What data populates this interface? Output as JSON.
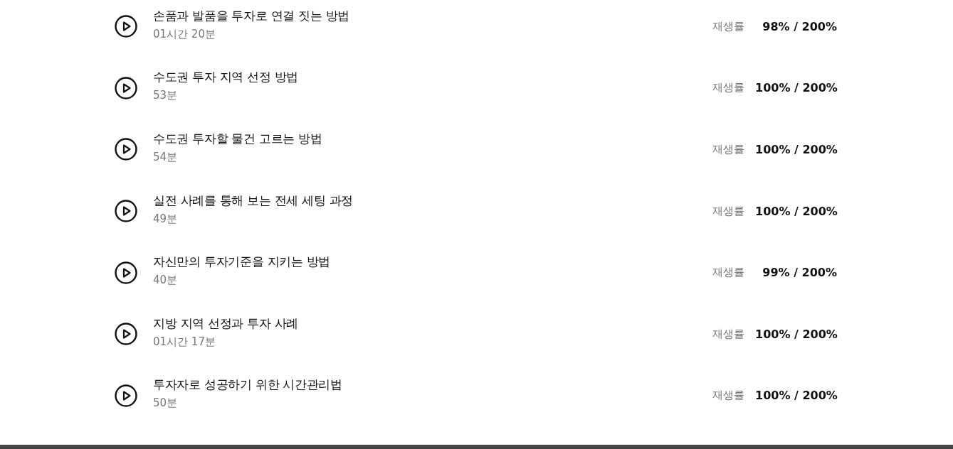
{
  "lessons": [
    {
      "title": "손품과 발품을 투자로 연결 짓는 방법",
      "duration": "01시간 20분",
      "rate_label": "재생률",
      "rate": "98% / 200%"
    },
    {
      "title": "수도권 투자 지역 선정 방법",
      "duration": "53분",
      "rate_label": "재생률",
      "rate": "100% / 200%"
    },
    {
      "title": "수도권 투자할 물건 고르는 방법",
      "duration": "54분",
      "rate_label": "재생률",
      "rate": "100% / 200%"
    },
    {
      "title": "실전 사례를 통해 보는 전세 세팅 과정",
      "duration": "49분",
      "rate_label": "재생률",
      "rate": "100% / 200%"
    },
    {
      "title": "자신만의 투자기준을 지키는 방법",
      "duration": "40분",
      "rate_label": "재생률",
      "rate": "99% / 200%"
    },
    {
      "title": "지방 지역 선정과 투자 사례",
      "duration": "01시간 17분",
      "rate_label": "재생률",
      "rate": "100% / 200%"
    },
    {
      "title": "투자자로 성공하기 위한 시간관리법",
      "duration": "50분",
      "rate_label": "재생률",
      "rate": "100% / 200%"
    }
  ]
}
